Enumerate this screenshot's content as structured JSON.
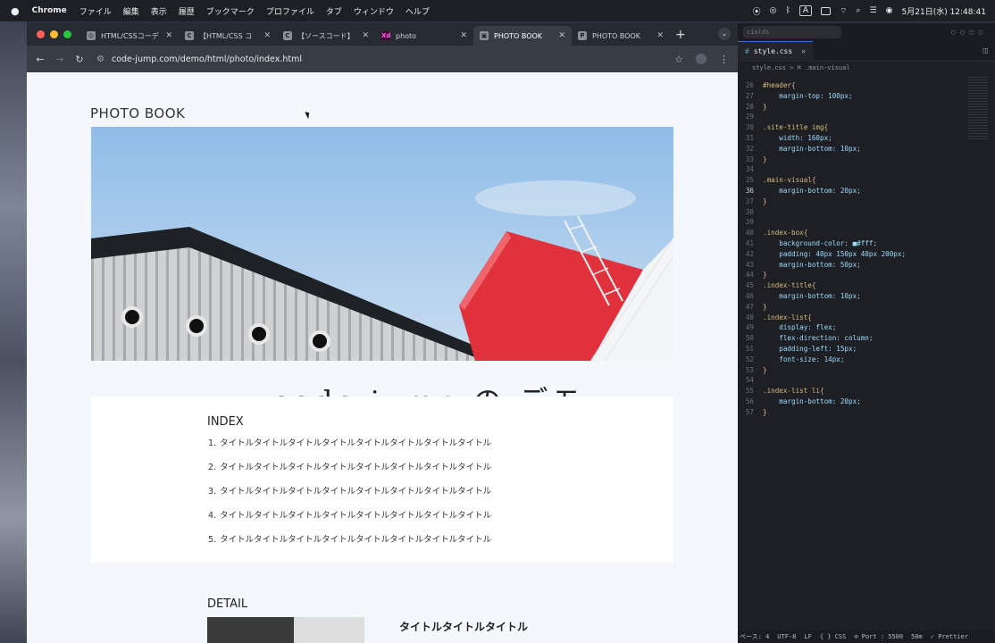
{
  "menubar": {
    "app": "Chrome",
    "items": [
      "ファイル",
      "編集",
      "表示",
      "履歴",
      "ブックマーク",
      "プロファイル",
      "タブ",
      "ウィンドウ",
      "ヘルプ"
    ],
    "clock": "5月21日(水) 12:48:41",
    "input_mode": "A"
  },
  "browser": {
    "tabs": [
      {
        "favicon": "globe-icon",
        "glyph": "◎",
        "title": "HTML/CSSコーデ",
        "active": false
      },
      {
        "favicon": "c-icon",
        "glyph": "C",
        "title": "【HTML/CSS コ",
        "active": false
      },
      {
        "favicon": "c-icon",
        "glyph": "C",
        "title": "【ソースコード】",
        "active": false
      },
      {
        "favicon": "xd-icon",
        "glyph": "Xd",
        "title": "photo",
        "active": false
      },
      {
        "favicon": "photobook-icon",
        "glyph": "▣",
        "title": "PHOTO BOOK",
        "active": true
      },
      {
        "favicon": "p-icon",
        "glyph": "P",
        "title": "PHOTO BOOK",
        "active": false
      }
    ],
    "url": "code-jump.com/demo/html/photo/index.html"
  },
  "page": {
    "site_title": "PHOTO BOOK",
    "overlay_text": "code jump の デモ",
    "index_title": "INDEX",
    "index_items": [
      "タイトルタイトルタイトルタイトルタイトルタイトルタイトルタイトル",
      "タイトルタイトルタイトルタイトルタイトルタイトルタイトルタイトル",
      "タイトルタイトルタイトルタイトルタイトルタイトルタイトルタイトル",
      "タイトルタイトルタイトルタイトルタイトルタイトルタイトルタイトル",
      "タイトルタイトルタイトルタイトルタイトルタイトルタイトルタイトル"
    ],
    "detail_title": "DETAIL",
    "detail_subtitle": "タイトルタイトルタイトル"
  },
  "editor": {
    "search": "ciolds",
    "tab": "style.css",
    "breadcrumb": "style.css  >  ⌘ .main-visual",
    "current_line": 36,
    "lines": [
      {
        "n": 26,
        "t": "#header{"
      },
      {
        "n": 27,
        "t": "    margin-top: 100px;"
      },
      {
        "n": 28,
        "t": "}"
      },
      {
        "n": 29,
        "t": ""
      },
      {
        "n": 30,
        "t": ".site-title img{"
      },
      {
        "n": 31,
        "t": "    width: 160px;"
      },
      {
        "n": 32,
        "t": "    margin-bottom: 10px;"
      },
      {
        "n": 33,
        "t": "}"
      },
      {
        "n": 34,
        "t": ""
      },
      {
        "n": 35,
        "t": ".main-visual{"
      },
      {
        "n": 36,
        "t": "    margin-bottom: 20px;"
      },
      {
        "n": 37,
        "t": "}"
      },
      {
        "n": 38,
        "t": ""
      },
      {
        "n": 39,
        "t": ""
      },
      {
        "n": 40,
        "t": ".index-box{"
      },
      {
        "n": 41,
        "t": "    background-color: ■#fff;"
      },
      {
        "n": 42,
        "t": "    padding: 40px 150px 40px 200px;"
      },
      {
        "n": 43,
        "t": "    margin-bottom: 50px;"
      },
      {
        "n": 44,
        "t": "}"
      },
      {
        "n": 45,
        "t": ".index-title{"
      },
      {
        "n": 46,
        "t": "    margin-bottom: 10px;"
      },
      {
        "n": 47,
        "t": "}"
      },
      {
        "n": 48,
        "t": ".index-list{"
      },
      {
        "n": 49,
        "t": "    display: flex;"
      },
      {
        "n": 50,
        "t": "    flex-direction: column;"
      },
      {
        "n": 51,
        "t": "    padding-left: 15px;"
      },
      {
        "n": 52,
        "t": "    font-size: 14px;"
      },
      {
        "n": 53,
        "t": "}"
      },
      {
        "n": 54,
        "t": ""
      },
      {
        "n": 55,
        "t": ".index-list li{"
      },
      {
        "n": 56,
        "t": "    margin-bottom: 20px;"
      },
      {
        "n": 57,
        "t": "}"
      }
    ],
    "status": {
      "spaces": "ペース: 4",
      "encoding": "UTF-8",
      "eol": "LF",
      "language": "{ } CSS",
      "port": "⊘ Port : 5500",
      "time": "50m",
      "formatter": "✓ Prettier"
    }
  }
}
